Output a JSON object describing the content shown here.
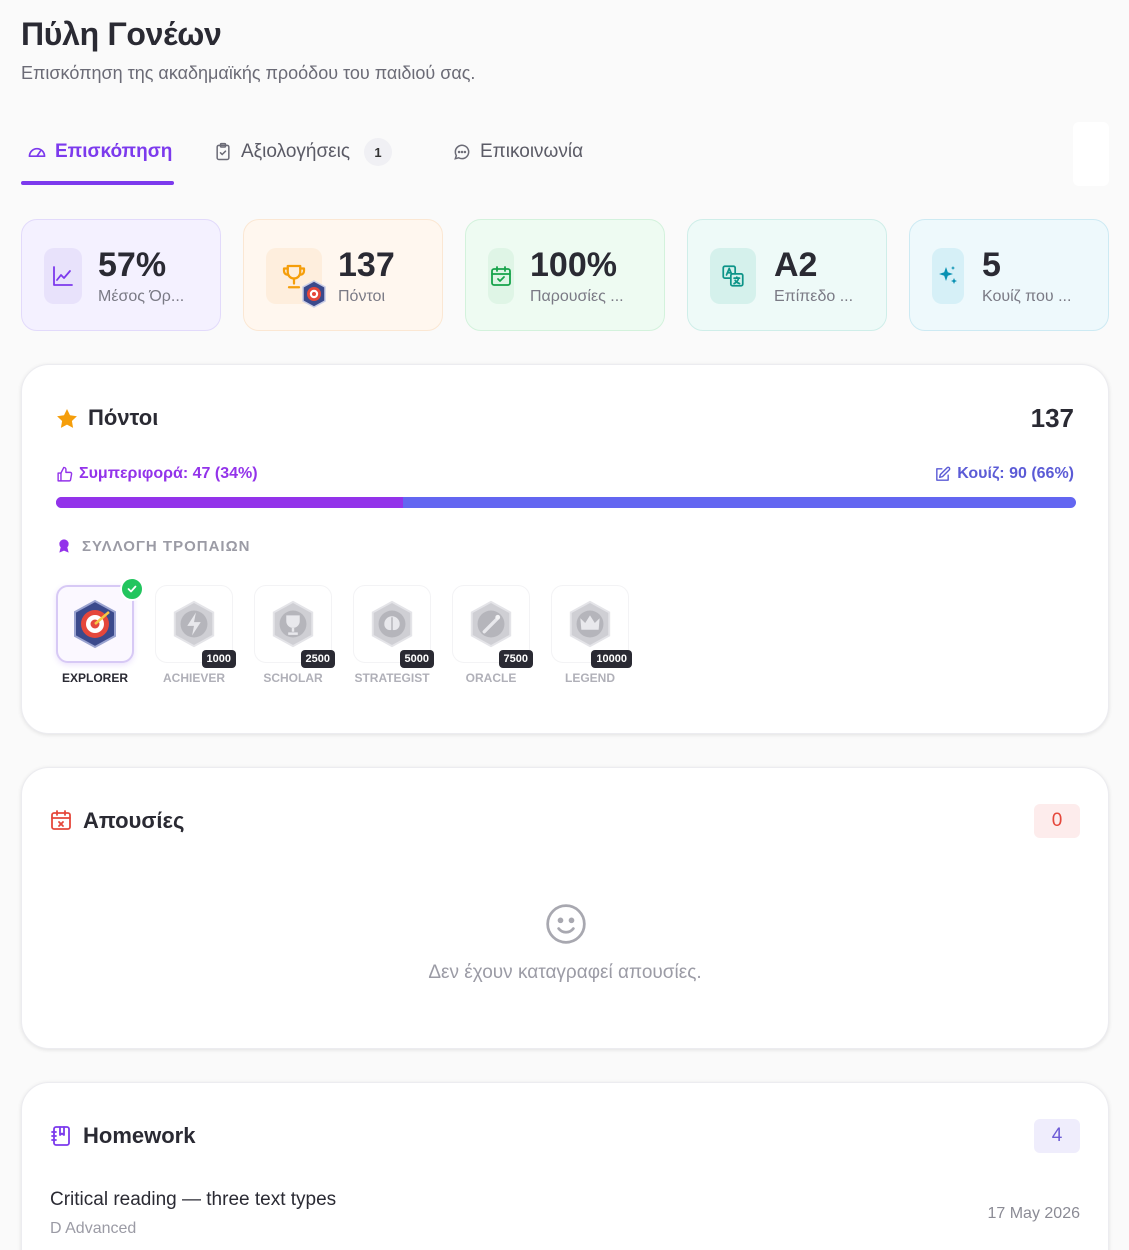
{
  "header": {
    "title": "Πύλη Γονέων",
    "subtitle": "Επισκόπηση της ακαδημαϊκής προόδου του παιδιού σας."
  },
  "tabs": [
    {
      "label": "Επισκόπηση",
      "icon": "gauge-icon",
      "active": true
    },
    {
      "label": "Αξιολογήσεις",
      "icon": "clipboard-icon",
      "badge": "1"
    },
    {
      "label": "Επικοινωνία",
      "icon": "chat-bubble-icon"
    }
  ],
  "stats": [
    {
      "value": "57%",
      "label": "Μέσος Όρ...",
      "icon": "line-chart-icon",
      "color": "#7c3aed"
    },
    {
      "value": "137",
      "label": "Πόντοι",
      "icon": "trophy-icon",
      "color": "#f59e0b"
    },
    {
      "value": "100%",
      "label": "Παρουσίες ...",
      "icon": "calendar-check-icon",
      "color": "#16a34a"
    },
    {
      "value": "A2",
      "label": "Επίπεδο ...",
      "icon": "translate-icon",
      "color": "#0d9488"
    },
    {
      "value": "5",
      "label": "Κουίζ που ...",
      "icon": "sparkles-icon",
      "color": "#0891b2"
    }
  ],
  "points": {
    "title": "Πόντοι",
    "total": "137",
    "behavior_label": "Συμπεριφορά: 47 (34%)",
    "quiz_label": "Κουίζ: 90 (66%)",
    "behavior_fraction": 0.34,
    "trophy_heading": "ΣΥΛΛΟΓΗ ΤΡΟΠΑΙΩΝ",
    "trophies": [
      {
        "name": "EXPLORER",
        "earned": true
      },
      {
        "name": "ACHIEVER",
        "requirement": "1000"
      },
      {
        "name": "SCHOLAR",
        "requirement": "2500"
      },
      {
        "name": "STRATEGIST",
        "requirement": "5000"
      },
      {
        "name": "ORACLE",
        "requirement": "7500"
      },
      {
        "name": "LEGEND",
        "requirement": "10000"
      }
    ]
  },
  "absences": {
    "title": "Απουσίες",
    "count": "0",
    "empty_text": "Δεν έχουν καταγραφεί απουσίες."
  },
  "homework": {
    "title": "Homework",
    "count": "4",
    "items": [
      {
        "title": "Critical reading — three text types",
        "class": "D Advanced",
        "date": "17 May 2026"
      }
    ]
  }
}
